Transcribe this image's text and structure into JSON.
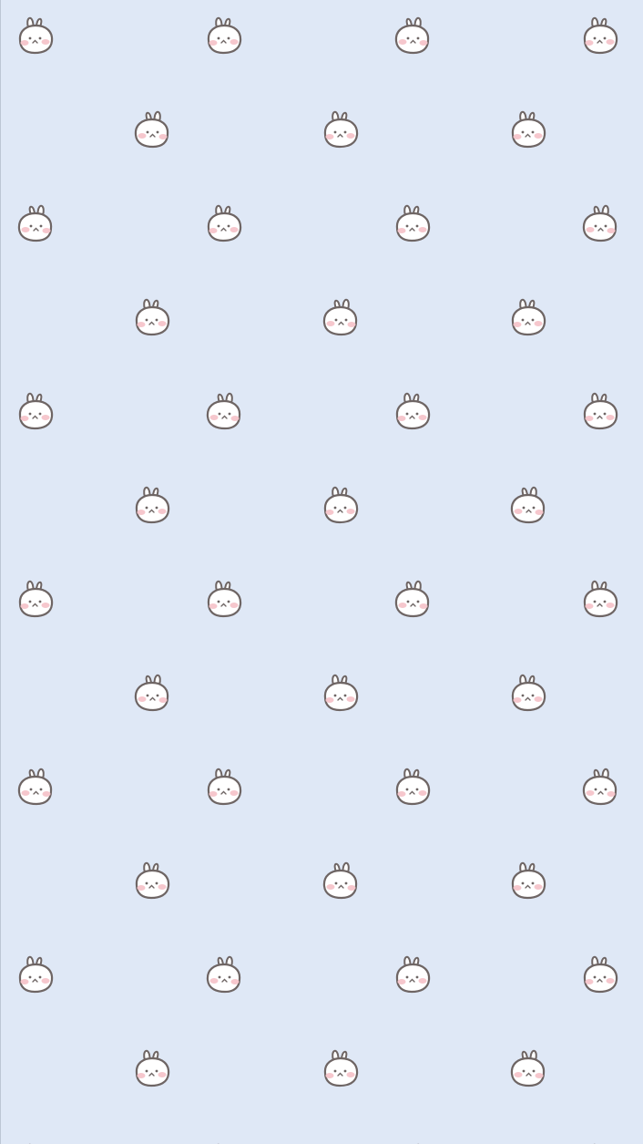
{
  "wallpaper": {
    "background_color": "#dfe8f6",
    "icon": "bunny-face-icon",
    "outline_color": "#6e6564",
    "face_color": "#ffffff",
    "blush_color": "#f6c7cd"
  }
}
